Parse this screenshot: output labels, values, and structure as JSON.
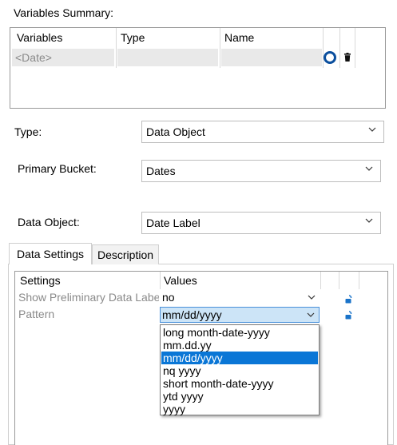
{
  "variables_summary": {
    "title": "Variables Summary:",
    "columns": [
      "Variables",
      "Type",
      "Name"
    ],
    "rows": [
      {
        "variable": "<Date>",
        "type": "",
        "name": ""
      }
    ],
    "row_icons": [
      "radio-selected-icon",
      "trash-icon"
    ]
  },
  "type_field": {
    "label": "Type:",
    "value": "Data Object"
  },
  "primary_bucket": {
    "label": "Primary Bucket:",
    "value": "Dates"
  },
  "data_object": {
    "label": "Data Object:",
    "value": "Date Label"
  },
  "tabs": [
    {
      "label": "Data Settings",
      "active": true
    },
    {
      "label": "Description",
      "active": false
    }
  ],
  "settings_table": {
    "columns": [
      "Settings",
      "Values"
    ],
    "rows": [
      {
        "setting": "Show Preliminary Data Labe",
        "value": "no",
        "icon": "unlock-icon"
      },
      {
        "setting": "Pattern",
        "value": "mm/dd/yyyy",
        "icon": "unlock-icon"
      }
    ]
  },
  "pattern_dropdown": {
    "options": [
      "long month-date-yyyy",
      "mm.dd.yy",
      "mm/dd/yyyy",
      "nq yyyy",
      "short month-date-yyyy",
      "ytd yyyy",
      "yyyy"
    ],
    "selected": "mm/dd/yyyy"
  },
  "colors": {
    "accent": "#0a76d6",
    "highlight_bg": "#cce4f7",
    "header_gray": "#e9e9e9"
  }
}
